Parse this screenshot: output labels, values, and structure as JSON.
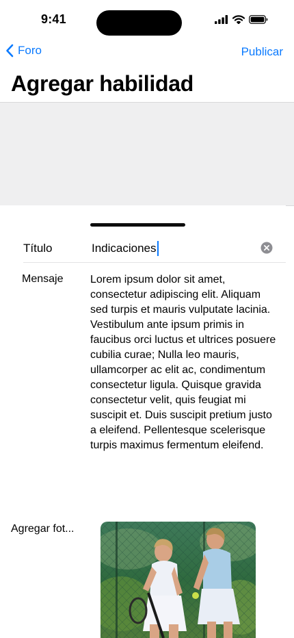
{
  "status_bar": {
    "time": "9:41",
    "icons": [
      "cellular-signal-icon",
      "wifi-icon",
      "battery-icon"
    ]
  },
  "nav": {
    "back_label": "Foro",
    "back_icon": "chevron-left-icon",
    "action_label": "Publicar"
  },
  "page": {
    "title": "Agregar habilidad"
  },
  "form": {
    "title_label": "Título",
    "title_value": "Indicaciones",
    "message_label": "Mensaje",
    "message_value": "Lorem ipsum dolor sit amet, consectetur adipiscing elit. Aliquam sed turpis et mauris vulputate lacinia. Vestibulum ante ipsum primis in faucibus orci luctus et ultrices posuere cubilia curae; Nulla leo mauris, ullamcorper ac elit ac, condimentum consectetur ligula. Quisque gravida consectetur velit, quis feugiat mi suscipit et. Duis suscipit pretium justo a eleifend. Pellentesque scelerisque turpis maximus fermentum eleifend.",
    "photo_label": "Agregar fot..."
  },
  "colors": {
    "accent": "#0a7aff",
    "gray_background": "#efeff0"
  }
}
